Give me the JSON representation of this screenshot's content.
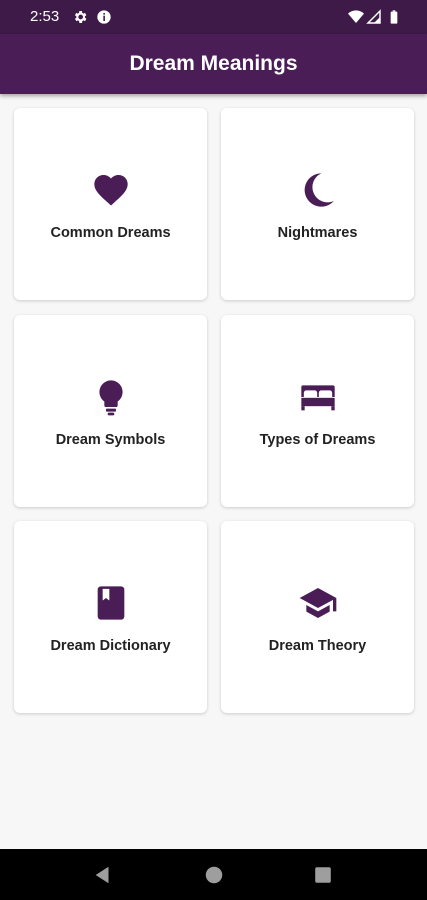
{
  "status_bar": {
    "time": "2:53",
    "icons": [
      "gear-icon",
      "info-icon",
      "wifi-icon",
      "signal-icon",
      "battery-icon"
    ]
  },
  "app_bar": {
    "title": "Dream Meanings",
    "color": "#4a1d56"
  },
  "accent_color": "#4a1d56",
  "cards": [
    {
      "label": "Common Dreams",
      "icon": "heart-icon"
    },
    {
      "label": "Nightmares",
      "icon": "moon-icon"
    },
    {
      "label": "Dream Symbols",
      "icon": "lightbulb-icon"
    },
    {
      "label": "Types of Dreams",
      "icon": "bed-icon"
    },
    {
      "label": "Dream Dictionary",
      "icon": "book-icon"
    },
    {
      "label": "Dream Theory",
      "icon": "graduation-cap-icon"
    }
  ],
  "nav_bar": {
    "buttons": [
      "back-icon",
      "home-icon",
      "recents-icon"
    ]
  }
}
